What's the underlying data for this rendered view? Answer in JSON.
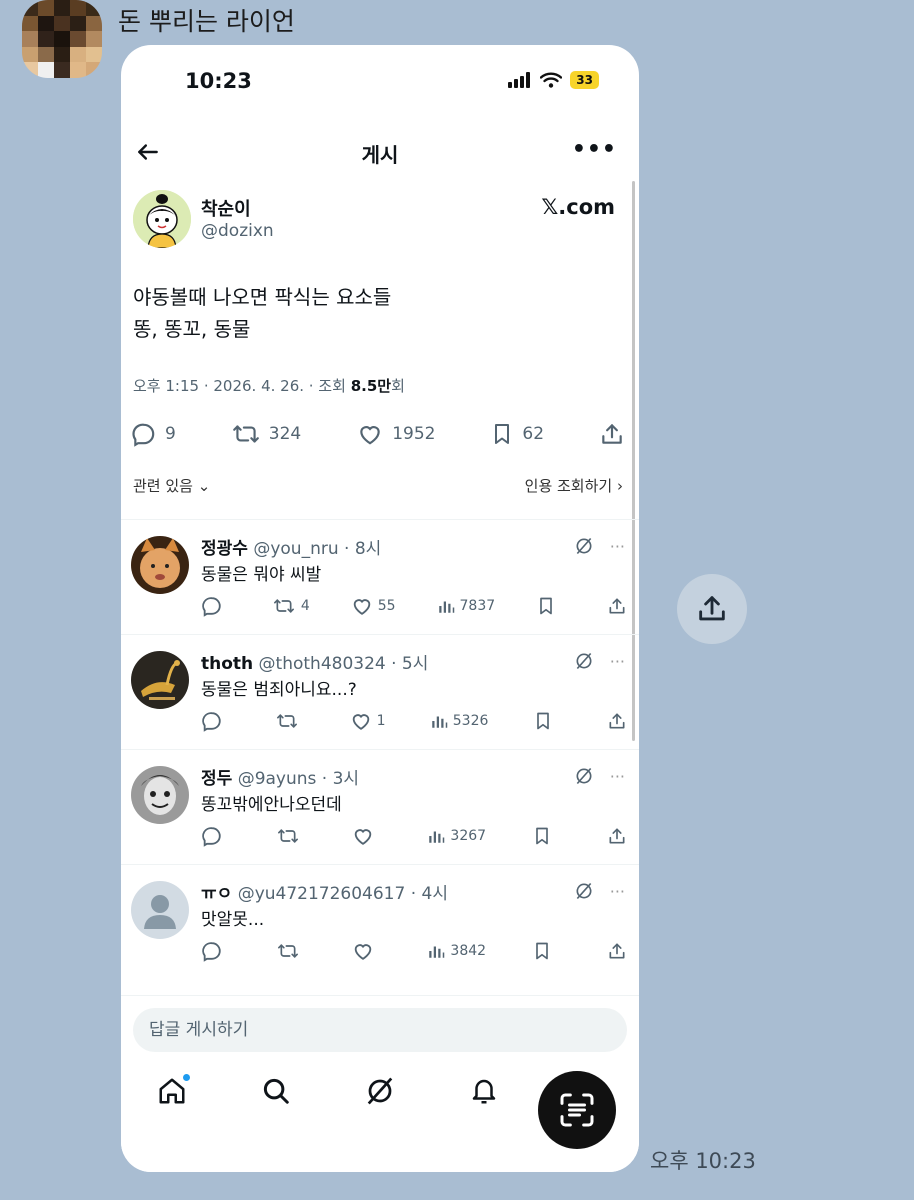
{
  "chat": {
    "sender_name": "돈 뿌리는 라이언",
    "message_time": "오후 10:23"
  },
  "status_bar": {
    "time": "10:23",
    "battery": "33"
  },
  "header": {
    "title": "게시",
    "back_icon": "arrow-left-icon",
    "more_icon": "more-icon"
  },
  "post": {
    "author_name": "착순이",
    "author_handle": "@dozixn",
    "brand": "𝕏.com",
    "text_line1": "야동볼때 나오면 팍식는 요소들",
    "text_line2": "똥, 똥꼬, 동물",
    "meta_prefix": "오후 1:15 · 2026. 4. 26. · 조회 ",
    "meta_views": "8.5만",
    "meta_suffix": "회",
    "replies": "9",
    "reposts": "324",
    "likes": "1952",
    "bookmarks": "62",
    "related_label": "관련 있음",
    "quotes_label": "인용 조회하기"
  },
  "replies": [
    {
      "name": "정광수",
      "handle": "@you_nru · 8시",
      "text": "동물은 뭐야 씨발",
      "reposts": "4",
      "likes": "55",
      "views": "7837"
    },
    {
      "name": "thoth",
      "handle": "@thoth480324 · 5시",
      "text": "동물은 범죄아니요...?",
      "reposts": "",
      "likes": "1",
      "views": "5326"
    },
    {
      "name": "정두",
      "handle": "@9ayuns · 3시",
      "text": "똥꼬밖에안나오던데",
      "reposts": "",
      "likes": "",
      "views": "3267"
    },
    {
      "name": "ㅠㅇ",
      "handle": "@yu472172604617 · 4시",
      "text": "맛알못...",
      "reposts": "",
      "likes": "",
      "views": "3842"
    }
  ],
  "composer": {
    "placeholder": "답글 게시하기"
  },
  "tabs": [
    "home-icon",
    "search-icon",
    "grok-icon",
    "bell-icon"
  ],
  "colors": {
    "chat_background": "#a9bdd2",
    "accent": "#1d9bf0",
    "battery": "#f7d42a"
  }
}
